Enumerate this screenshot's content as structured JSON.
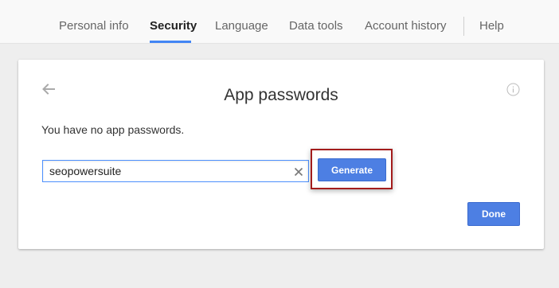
{
  "nav": {
    "tabs": [
      {
        "label": "Personal info",
        "active": false
      },
      {
        "label": "Security",
        "active": true
      },
      {
        "label": "Language",
        "active": false
      },
      {
        "label": "Data tools",
        "active": false
      },
      {
        "label": "Account history",
        "active": false
      }
    ],
    "help_label": "Help"
  },
  "card": {
    "title": "App passwords",
    "message": "You have no app passwords.",
    "back_icon": "arrow-left-icon",
    "info_icon": "info-circle-icon",
    "input": {
      "value": "seopowersuite",
      "placeholder": ""
    },
    "clear_icon": "close-icon",
    "generate_label": "Generate",
    "done_label": "Done"
  },
  "colors": {
    "accent": "#4285f4",
    "button": "#4d7fe3",
    "highlight": "#a31c1c",
    "background": "#eeeeee"
  }
}
